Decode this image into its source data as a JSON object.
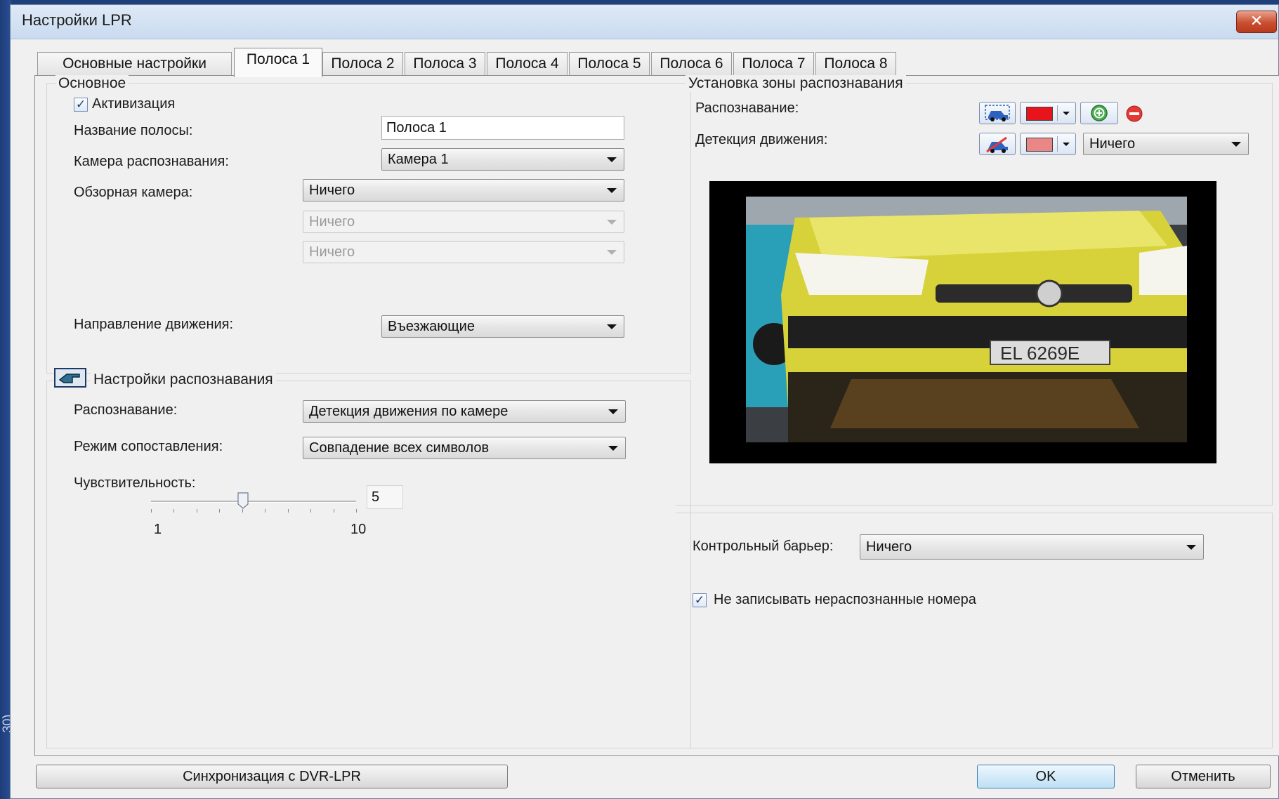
{
  "window": {
    "title": "Настройки LPR",
    "close_label": "✕"
  },
  "left_strip_text": "30)",
  "tabs": [
    {
      "label": "Основные настройки",
      "active": false
    },
    {
      "label": "Полоса 1",
      "active": true
    },
    {
      "label": "Полоса 2",
      "active": false
    },
    {
      "label": "Полоса 3",
      "active": false
    },
    {
      "label": "Полоса 4",
      "active": false
    },
    {
      "label": "Полоса 5",
      "active": false
    },
    {
      "label": "Полоса 6",
      "active": false
    },
    {
      "label": "Полоса 7",
      "active": false
    },
    {
      "label": "Полоса 8",
      "active": false
    }
  ],
  "basic": {
    "title": "Основное",
    "activation_label": "Активизация",
    "activation_checked": true,
    "lane_name_label": "Название полосы:",
    "lane_name_value": "Полоса 1",
    "rec_camera_label": "Камера распознавания:",
    "rec_camera_value": "Камера 1",
    "overview_camera_label": "Обзорная камера:",
    "overview_camera_value": "Ничего",
    "overview_camera_2_value": "Ничего",
    "overview_camera_3_value": "Ничего",
    "direction_label": "Направление движения:",
    "direction_value": "Въезжающие"
  },
  "recognition": {
    "title": "Настройки распознавания",
    "mode_label": "Распознавание:",
    "mode_value": "Детекция движения по камере",
    "match_label": "Режим сопоставления:",
    "match_value": "Совпадение всех символов",
    "sensitivity_label": "Чувствительность:",
    "sensitivity_value": "5",
    "slider_min": "1",
    "slider_max": "10",
    "slider_level": 0.45,
    "slider_ticks": 10
  },
  "zone": {
    "title": "Установка зоны распознавания",
    "rec_label": "Распознавание:",
    "motion_label": "Детекция движения:",
    "motion_value": "Ничего",
    "rec_color": "#e8141b",
    "motion_color": "#e98787"
  },
  "plate_text": "EL 6269E",
  "barrier": {
    "label": "Контрольный барьер:",
    "value": "Ничего",
    "skip_unrecognized_label": "Не записывать нераспознанные номера",
    "skip_unrecognized_checked": true
  },
  "footer": {
    "sync_label": "Синхронизация с DVR-LPR",
    "ok_label": "OK",
    "cancel_label": "Отменить"
  }
}
